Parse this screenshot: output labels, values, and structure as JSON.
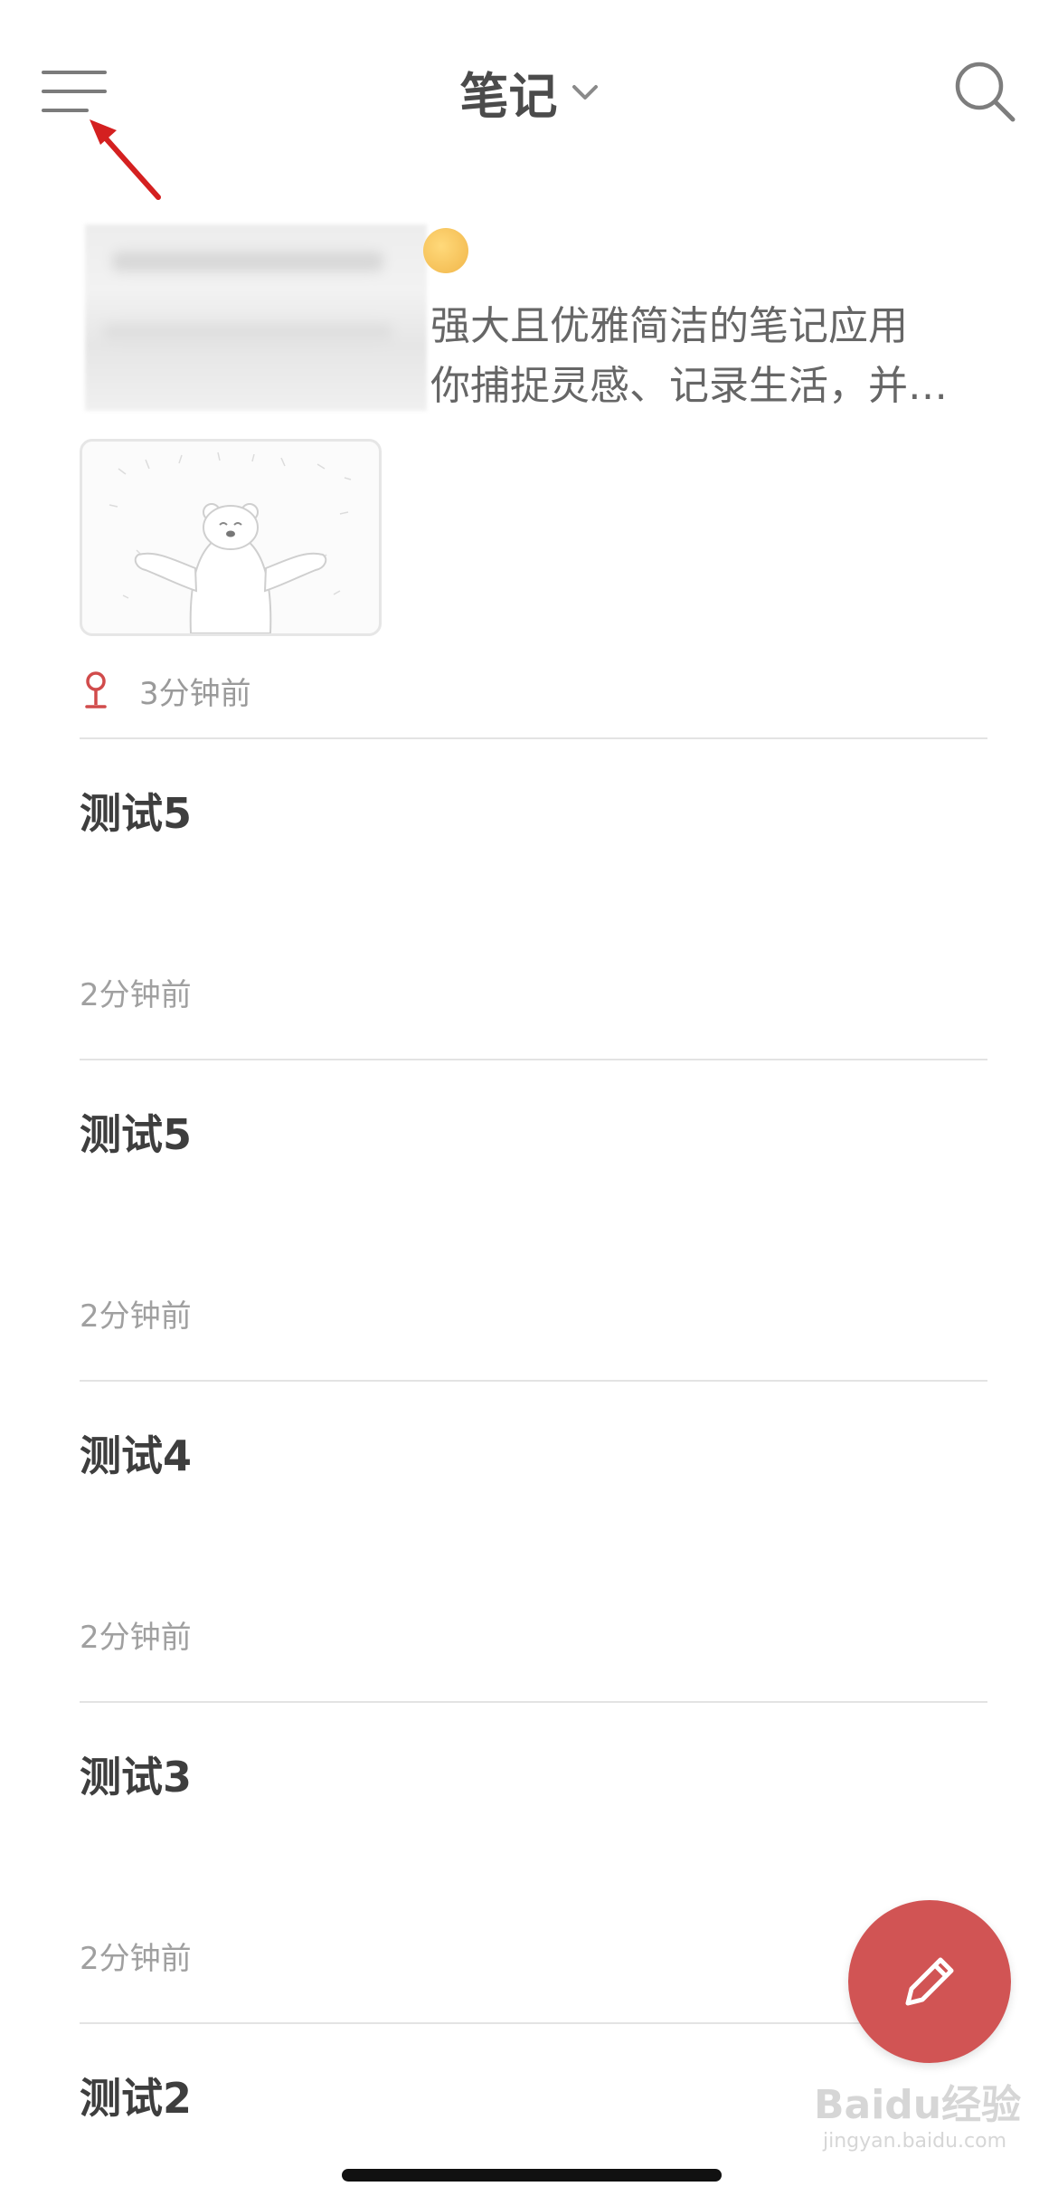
{
  "header": {
    "title": "笔记",
    "menu_icon": "hamburger-menu-icon",
    "search_icon": "search-icon",
    "dropdown_icon": "chevron-down-icon"
  },
  "featured_note": {
    "snippet_line1": "强大且优雅简洁的笔记应用",
    "snippet_line2": "你捕捉灵感、记录生活，并…",
    "time": "3分钟前",
    "pin_icon": "pin-icon"
  },
  "notes": [
    {
      "title": "测试5",
      "time": "2分钟前"
    },
    {
      "title": "测试5",
      "time": "2分钟前"
    },
    {
      "title": "测试4",
      "time": "2分钟前"
    },
    {
      "title": "测试3",
      "time": "2分钟前"
    },
    {
      "title": "测试2",
      "time": ""
    }
  ],
  "fab": {
    "icon": "pencil-icon"
  },
  "watermark": {
    "text": "Baidu经验",
    "sub": "jingyan.baidu.com"
  },
  "colors": {
    "accent": "#d15454",
    "text": "#3e3e3e",
    "muted": "#9a9a9a",
    "divider": "#e3e3e3"
  }
}
